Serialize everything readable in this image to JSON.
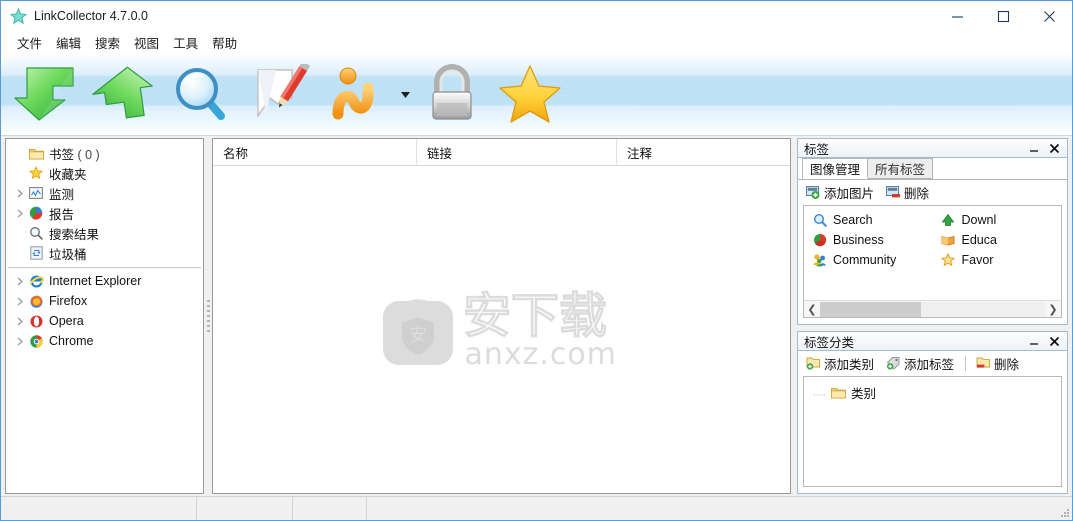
{
  "window": {
    "title": "LinkCollector 4.7.0.0",
    "app_icon": "star-icon",
    "minimize": "minimize-icon",
    "maximize": "maximize-icon",
    "close": "close-icon"
  },
  "menubar": {
    "items": [
      {
        "label": "文件"
      },
      {
        "label": "编辑"
      },
      {
        "label": "搜索"
      },
      {
        "label": "视图"
      },
      {
        "label": "工具"
      },
      {
        "label": "帮助"
      }
    ]
  },
  "toolbar": {
    "buttons": [
      {
        "name": "import-icon"
      },
      {
        "name": "export-icon"
      },
      {
        "name": "search-icon"
      },
      {
        "name": "edit-note-icon"
      },
      {
        "name": "sync-icon"
      },
      {
        "name": "lock-icon"
      },
      {
        "name": "favorites-star-icon"
      }
    ],
    "dropdown_caret": "chevron-down-icon"
  },
  "tree": {
    "groups": [
      {
        "items": [
          {
            "label": "书签",
            "count": "( 0 )",
            "icon": "folder-icon",
            "expandable": false
          },
          {
            "label": "收藏夹",
            "count": "",
            "icon": "star-icon",
            "expandable": false
          },
          {
            "label": "监测",
            "count": "",
            "icon": "monitor-icon",
            "expandable": true
          },
          {
            "label": "报告",
            "count": "",
            "icon": "pie-chart-icon",
            "expandable": true
          },
          {
            "label": "搜索结果",
            "count": "",
            "icon": "magnifier-icon",
            "expandable": false
          },
          {
            "label": "垃圾桶",
            "count": "",
            "icon": "recycle-bin-icon",
            "expandable": false
          }
        ]
      },
      {
        "items": [
          {
            "label": "Internet Explorer",
            "count": "",
            "icon": "ie-icon",
            "expandable": true
          },
          {
            "label": "Firefox",
            "count": "",
            "icon": "firefox-icon",
            "expandable": true
          },
          {
            "label": "Opera",
            "count": "",
            "icon": "opera-icon",
            "expandable": true
          },
          {
            "label": "Chrome",
            "count": "",
            "icon": "chrome-icon",
            "expandable": true
          }
        ]
      }
    ]
  },
  "list": {
    "columns": [
      {
        "label": "名称"
      },
      {
        "label": "链接"
      },
      {
        "label": "注释"
      }
    ],
    "rows": [],
    "watermark": {
      "cn": "安下载",
      "en": "anxz.com",
      "logo_glyph": "安"
    }
  },
  "tags_panel": {
    "title": "标签",
    "minimize": "minimize-icon",
    "close": "close-icon",
    "tabs": [
      {
        "label": "图像管理",
        "active": true
      },
      {
        "label": "所有标签",
        "active": false
      }
    ],
    "toolbar": [
      {
        "label": "添加图片",
        "icon": "add-image-icon"
      },
      {
        "label": "删除",
        "icon": "delete-image-icon"
      }
    ],
    "items_left": [
      {
        "label": "Search",
        "icon": "magnifier-icon"
      },
      {
        "label": "Business",
        "icon": "pie-chart-icon"
      },
      {
        "label": "Community",
        "icon": "people-icon"
      }
    ],
    "items_right": [
      {
        "label": "Downl",
        "icon": "download-arrow-icon"
      },
      {
        "label": "Educa",
        "icon": "book-icon"
      },
      {
        "label": "Favor",
        "icon": "star-icon"
      }
    ],
    "scrollbar": {
      "left_arrow": "chevron-left-icon",
      "right_arrow": "chevron-right-icon"
    }
  },
  "categories_panel": {
    "title": "标签分类",
    "minimize": "minimize-icon",
    "close": "close-icon",
    "toolbar": [
      {
        "label": "添加类别",
        "icon": "add-category-icon"
      },
      {
        "label": "添加标签",
        "icon": "add-tag-icon"
      },
      {
        "label": "删除",
        "icon": "delete-category-icon"
      }
    ],
    "tree": [
      {
        "label": "类别",
        "icon": "folder-icon"
      }
    ]
  },
  "statusbar": {
    "segments": [
      "",
      "",
      "",
      ""
    ]
  },
  "colors": {
    "accent": "#5b9bd5",
    "toolbar_blue": "#bfe2f7",
    "dock_border": "#a5bcd0",
    "watermark_gray": "#dcdcdc"
  }
}
